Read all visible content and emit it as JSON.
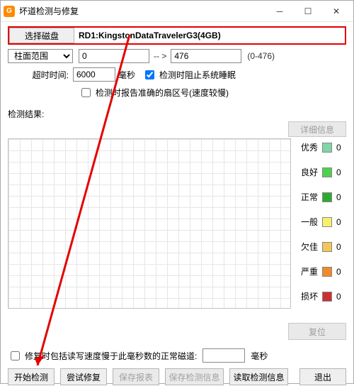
{
  "window": {
    "title": "坏道检测与修复",
    "logo": "G"
  },
  "disk": {
    "select_button": "选择磁盘",
    "name": "RD1:KingstonDataTravelerG3(4GB)"
  },
  "cylinder": {
    "mode_label": "柱面范围",
    "from": "0",
    "arrow": "-- >",
    "to": "476",
    "range_hint": "(0-476)"
  },
  "timeout": {
    "label": "超时时间:",
    "value": "6000",
    "unit": "毫秒"
  },
  "sleep_block": {
    "label": "检测时阻止系统睡眠"
  },
  "accurate": {
    "label": "检测时报告准确的扇区号(速度较慢)"
  },
  "results": {
    "heading": "检测结果:",
    "detail_button": "详细信息"
  },
  "legend": [
    {
      "label": "优秀",
      "color": "#7fd6a6",
      "count": "0"
    },
    {
      "label": "良好",
      "color": "#4fd04f",
      "count": "0"
    },
    {
      "label": "正常",
      "color": "#2fa82f",
      "count": "0"
    },
    {
      "label": "一般",
      "color": "#f8f06a",
      "count": "0"
    },
    {
      "label": "欠佳",
      "color": "#f4c55a",
      "count": "0"
    },
    {
      "label": "严重",
      "color": "#f08a2a",
      "count": "0"
    },
    {
      "label": "损坏",
      "color": "#c93030",
      "count": "0"
    }
  ],
  "reset_button": "复位",
  "repair": {
    "label_pre": "修复时包括读写速度慢于此毫秒数的正常磁道:",
    "value": "",
    "unit": "毫秒"
  },
  "footer": {
    "start": "开始检测",
    "try_repair": "尝试修复",
    "save_report": "保存报表",
    "save_info": "保存检测信息",
    "load_info": "读取检测信息",
    "exit": "退出"
  }
}
